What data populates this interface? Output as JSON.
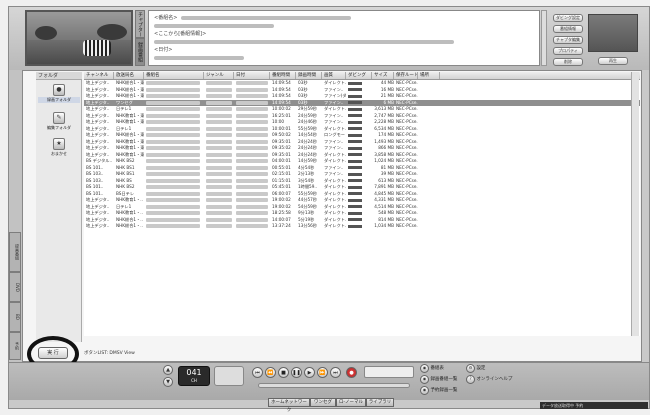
{
  "info": {
    "title_label": "<番組名>",
    "detail_label": "<ここから[番組情報]>",
    "date_label": "<日付>"
  },
  "left_tabs": [
    {
      "label": "チャプター"
    },
    {
      "label": "録画番組"
    }
  ],
  "right_buttons": [
    {
      "label": "ダビング設定"
    },
    {
      "label": "番組情報"
    },
    {
      "label": "チャプタ編集"
    },
    {
      "label": "プロパティ"
    },
    {
      "label": "削除"
    },
    {
      "label": "再生"
    }
  ],
  "side_tabs": [
    {
      "label": "録画番組"
    },
    {
      "label": "DVD"
    },
    {
      "label": "BD"
    },
    {
      "label": "予約"
    }
  ],
  "folder_pane": {
    "header": "フォルダ",
    "items": [
      {
        "label": "録画フォルダ",
        "icon": "recording-folder-icon",
        "glyph": "●"
      },
      {
        "label": "編集フォルダ",
        "icon": "edit-folder-icon",
        "glyph": "✎"
      },
      {
        "label": "おまかせ",
        "icon": "auto-icon",
        "glyph": "★"
      }
    ]
  },
  "table": {
    "columns": [
      "チャンネル",
      "放送局名",
      "番組名",
      "ジャンル",
      "日付",
      "番組時間",
      "録画時間",
      "画質",
      "ダビング",
      "サイズ",
      "保存ルート",
      "場所"
    ],
    "rows": [
      {
        "ch": "地上デジタ..",
        "station": "NHK総合1・東..",
        "dur": "14:09:54",
        "rec": "03秒",
        "q": "ダイレクト..",
        "size": "44 MB",
        "dest": "NEC-PCse.."
      },
      {
        "ch": "地上デジタ..",
        "station": "NHK総合1・東..",
        "dur": "14:09:54",
        "rec": "03秒",
        "q": "ファイン..",
        "size": "16 MB",
        "dest": "NEC-PCse.."
      },
      {
        "ch": "地上デジタ..",
        "station": "NHK総合1・東..",
        "dur": "14:09:54",
        "rec": "03秒",
        "q": "ファイン(ダ..",
        "size": "21 MB",
        "dest": "NEC-PCse.."
      },
      {
        "ch": "地上デジタ..",
        "station": "ワンセグ",
        "dur": "14:09:54",
        "rec": "03秒",
        "q": "ファイン..",
        "size": "6 MB",
        "dest": "NEC-PCse.."
      },
      {
        "ch": "地上デジタ..",
        "station": "日テレ1",
        "dur": "10:00:02",
        "rec": "29分59秒",
        "q": "ダイレクト..",
        "size": "3,613 MB",
        "dest": "NEC-PCse.."
      },
      {
        "ch": "地上デジタ..",
        "station": "NHK教育1・東..",
        "dur": "16:25:01",
        "rec": "24分59秒",
        "q": "ファイン..",
        "size": "2,747 MB",
        "dest": "NEC-PCse.."
      },
      {
        "ch": "地上デジタ..",
        "station": "NHK教育1・東..",
        "dur": "10:00",
        "rec": "24分46秒",
        "q": "ファイン..",
        "size": "2,228 MB",
        "dest": "NEC-PCse.."
      },
      {
        "ch": "地上デジタ..",
        "station": "日テレ1",
        "dur": "10:00:01",
        "rec": "55分59秒",
        "q": "ダイレクト..",
        "size": "6,534 MB",
        "dest": "NEC-PCse.."
      },
      {
        "ch": "地上デジタ..",
        "station": "NHK総合1・東..",
        "dur": "09:50:02",
        "rec": "14分54秒",
        "q": "ロングモード",
        "size": "174 MB",
        "dest": "NEC-PCse.."
      },
      {
        "ch": "地上デジタ..",
        "station": "NHK教育1・東..",
        "dur": "09:35:01",
        "rec": "24分24秒",
        "q": "ファイン..",
        "size": "1,493 MB",
        "dest": "NEC-PCse.."
      },
      {
        "ch": "地上デジタ..",
        "station": "NHK教育1・東..",
        "dur": "09:35:02",
        "rec": "24分24秒",
        "q": "ファイン..",
        "size": "866 MB",
        "dest": "NEC-PCse.."
      },
      {
        "ch": "地上デジタ..",
        "station": "NHK教育1・東..",
        "dur": "09:35:01",
        "rec": "24分24秒",
        "q": "ダイレクト..",
        "size": "3,858 MB",
        "dest": "NEC-PCse.."
      },
      {
        "ch": "BS デジタル..",
        "station": "NHK BS2",
        "dur": "04:00:01",
        "rec": "14分59秒",
        "q": "ダイレクト..",
        "size": "1,024 MB",
        "dest": "NEC-PCse.."
      },
      {
        "ch": "BS 101..",
        "station": "NHK BS1",
        "dur": "00:55:01",
        "rec": "4分54秒",
        "q": "ファイン..",
        "size": "81 MB",
        "dest": "NEC-PCse.."
      },
      {
        "ch": "BS 103..",
        "station": "NHK BS1",
        "dur": "02:15:01",
        "rec": "2分13秒",
        "q": "ファイン..",
        "size": "39 MB",
        "dest": "NEC-PCse.."
      },
      {
        "ch": "BS 103..",
        "station": "NHK BS",
        "dur": "01:15:01",
        "rec": "3分54秒",
        "q": "ダイレクト..",
        "size": "613 MB",
        "dest": "NEC-PCse.."
      },
      {
        "ch": "BS 101..",
        "station": "NHK BS2",
        "dur": "05:45:01",
        "rec": "1時間59..",
        "q": "ダイレクト..",
        "size": "7,891 MB",
        "dest": "NEC-PCse.."
      },
      {
        "ch": "BS 101..",
        "station": "BS日テレ",
        "dur": "06:00:07",
        "rec": "55分59秒",
        "q": "ダイレクト..",
        "size": "4,845 MB",
        "dest": "NEC-PCse.."
      },
      {
        "ch": "地上デジタ..",
        "station": "NHK教育1・..",
        "dur": "19:00:02",
        "rec": "44分57秒",
        "q": "ダイレクト..",
        "size": "4,331 MB",
        "dest": "NEC-PCse.."
      },
      {
        "ch": "地上デジタ..",
        "station": "日テレ1",
        "dur": "19:00:02",
        "rec": "54分59秒",
        "q": "ダイレクト..",
        "size": "4,514 MB",
        "dest": "NEC-PCse.."
      },
      {
        "ch": "地上デジタ..",
        "station": "NHK教育1・..",
        "dur": "18:25:58",
        "rec": "9分13秒",
        "q": "ダイレクト..",
        "size": "548 MB",
        "dest": "NEC-PCse.."
      },
      {
        "ch": "地上デジタ..",
        "station": "NHK総合1・..",
        "dur": "14:00:07",
        "rec": "5分19秒",
        "q": "ダイレクト..",
        "size": "814 MB",
        "dest": "NEC-PCse.."
      },
      {
        "ch": "地上デジタ..",
        "station": "NHK総合1・..",
        "dur": "13:37:24",
        "rec": "13分56秒",
        "q": "ダイレクト..",
        "size": "1,034 MB",
        "dest": "NEC-PCse.."
      }
    ],
    "selected_row": 3
  },
  "status_text": "ボタンLIST: DMSV View",
  "execute_button": "実 行",
  "controls": {
    "channel_number": "041",
    "channel_sub": "CH"
  },
  "nav_tabs": [
    {
      "label": "ホームネットワーク"
    },
    {
      "label": "ワンセグ"
    },
    {
      "label": "ロ-ノーマル"
    },
    {
      "label": "ライブラリ"
    }
  ],
  "right_options": [
    {
      "label": "番組表",
      "icon": "tv-guide-icon"
    },
    {
      "label": "録画番組一覧",
      "icon": "recorded-list-icon"
    },
    {
      "label": "予約録画一覧",
      "icon": "reservation-list-icon"
    },
    {
      "label": "設定",
      "icon": "settings-icon"
    },
    {
      "label": "オンラインヘルプ",
      "icon": "help-icon"
    }
  ],
  "statusbar_text": "データ放送取得中 予約"
}
